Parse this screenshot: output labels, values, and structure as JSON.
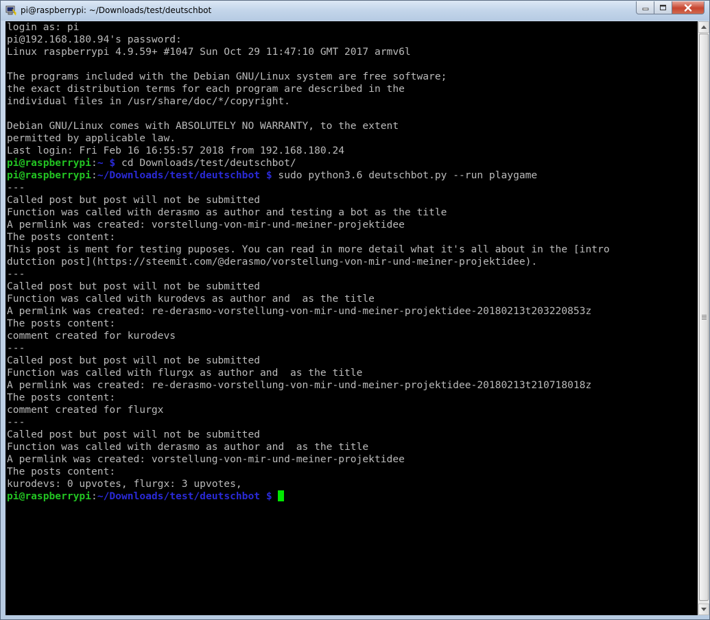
{
  "window": {
    "title": "pi@raspberrypi: ~/Downloads/test/deutschbot"
  },
  "prompt": {
    "user_host": "pi@raspberrypi",
    "colon": ":",
    "home_path": "~ $",
    "dir_path": "~/Downloads/test/deutschbot $"
  },
  "terminal": {
    "lines": [
      "login as: pi",
      "pi@192.168.180.94's password:",
      "Linux raspberrypi 4.9.59+ #1047 Sun Oct 29 11:47:10 GMT 2017 armv6l",
      "",
      "The programs included with the Debian GNU/Linux system are free software;",
      "the exact distribution terms for each program are described in the",
      "individual files in /usr/share/doc/*/copyright.",
      "",
      "Debian GNU/Linux comes with ABSOLUTELY NO WARRANTY, to the extent",
      "permitted by applicable law.",
      "Last login: Fri Feb 16 16:55:57 2018 from 192.168.180.24",
      " cd Downloads/test/deutschbot/",
      " sudo python3.6 deutschbot.py --run playgame",
      "---",
      "Called post but post will not be submitted",
      "Function was called with derasmo as author and testing a bot as the title",
      "A permlink was created: vorstellung-von-mir-und-meiner-projektidee",
      "The posts content:",
      "This post is ment for testing puposes. You can read in more detail what it's all about in the [intro",
      "dutction post](https://steemit.com/@derasmo/vorstellung-von-mir-und-meiner-projektidee).",
      "---",
      "Called post but post will not be submitted",
      "Function was called with kurodevs as author and  as the title",
      "A permlink was created: re-derasmo-vorstellung-von-mir-und-meiner-projektidee-20180213t203220853z",
      "The posts content:",
      "comment created for kurodevs",
      "---",
      "Called post but post will not be submitted",
      "Function was called with flurgx as author and  as the title",
      "A permlink was created: re-derasmo-vorstellung-von-mir-und-meiner-projektidee-20180213t210718018z",
      "The posts content:",
      "comment created for flurgx",
      "---",
      "Called post but post will not be submitted",
      "Function was called with derasmo as author and  as the title",
      "A permlink was created: vorstellung-von-mir-und-meiner-projektidee",
      "The posts content:",
      "kurodevs: 0 upvotes, flurgx: 3 upvotes,",
      ""
    ]
  },
  "colors": {
    "prompt_user": "#22c322",
    "prompt_path": "#2a2ad6",
    "cursor": "#00e600",
    "terminal_bg": "#000000",
    "terminal_fg": "#bbbbbb"
  },
  "icons": {
    "app": "putty-terminal-icon",
    "minimize": "minimize-icon",
    "maximize": "maximize-icon",
    "close": "close-icon"
  }
}
